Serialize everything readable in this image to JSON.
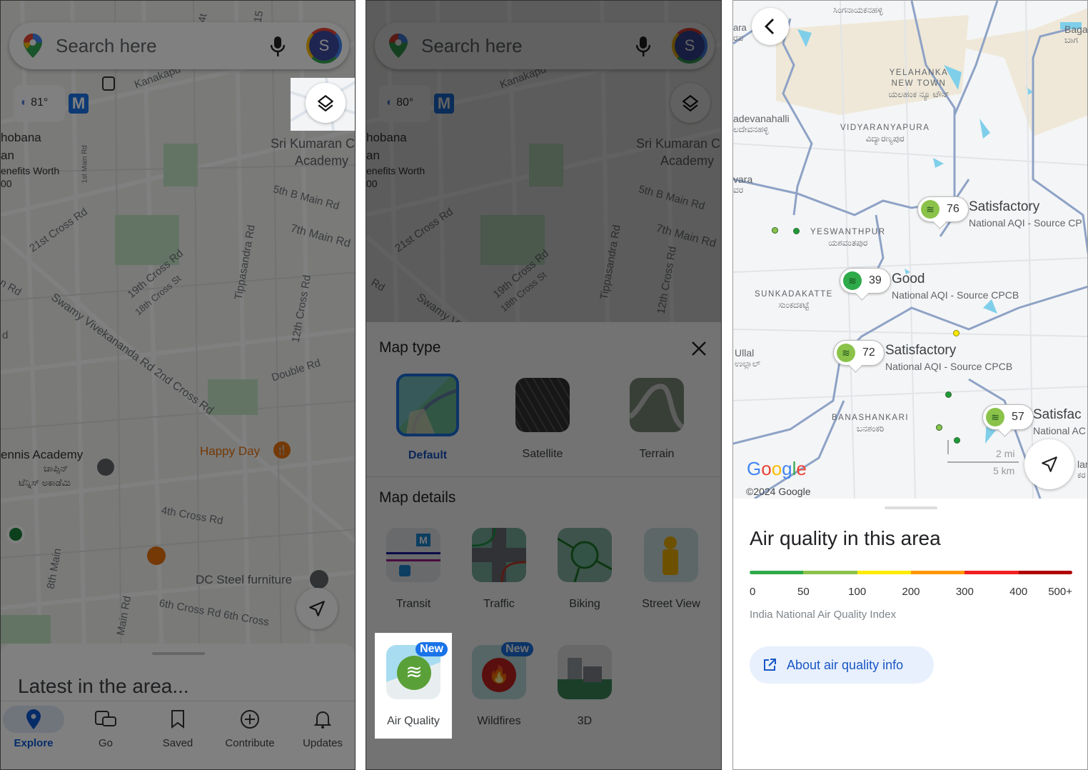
{
  "panel1": {
    "search_placeholder": "Search here",
    "avatar_letter": "S",
    "temperature": "81°",
    "metro_badge": "M",
    "map_labels": [
      "Kanakapu",
      "Sri Kumaran C",
      "Academy",
      "hobana",
      "an",
      "enefits Worth",
      "00",
      "1st Main Rd",
      "5th B Main Rd",
      "21st Cross Rd",
      "7th Main Rd",
      "19th Cross Rd",
      "18th Cross St",
      "Tippasandra Rd",
      "12th Cross Rd",
      "Swamy Vivekananda Rd 2nd Cross Rd",
      "Double Rd",
      "Happy Day",
      "ennis Academy",
      "ಚಾಪ್ಸಿನ್",
      "ಟೆನ್ನಿಸ್ ಅಕಾಡೆಮಿ",
      "4th Cross Rd",
      "8th Main",
      "DC Steel furniture",
      "6th Cross Rd 6th Cross",
      "Main Rd",
      "n Rd",
      "d",
      "4t",
      "15"
    ],
    "sheet_title": "Latest in the area...",
    "nav": [
      {
        "label": "Explore",
        "icon": "pin-icon",
        "active": true
      },
      {
        "label": "Go",
        "icon": "commute-icon"
      },
      {
        "label": "Saved",
        "icon": "bookmark-icon"
      },
      {
        "label": "Contribute",
        "icon": "plus-circle-icon"
      },
      {
        "label": "Updates",
        "icon": "bell-icon"
      }
    ]
  },
  "panel2": {
    "search_placeholder": "Search here",
    "avatar_letter": "S",
    "temperature": "80°",
    "metro_badge": "M",
    "map_labels": [
      "Kanakapu",
      "Sri Kumaran C",
      "Academy",
      "hobana",
      "an",
      "enefits Worth",
      "00",
      "5th B Main Rd",
      "21st Cross Rd",
      "7th Main Rd",
      "19th Cross Rd",
      "18th Cross St",
      "Tippasandra Rd",
      "12th Cross Rd",
      "Swamy Vi",
      "Rd"
    ],
    "map_type_title": "Map type",
    "map_types": [
      {
        "label": "Default",
        "selected": true
      },
      {
        "label": "Satellite"
      },
      {
        "label": "Terrain"
      }
    ],
    "map_details_title": "Map details",
    "details": [
      {
        "label": "Transit"
      },
      {
        "label": "Traffic"
      },
      {
        "label": "Biking"
      },
      {
        "label": "Street View"
      },
      {
        "label": "Air Quality",
        "badge": "New",
        "highlighted": true
      },
      {
        "label": "Wildfires",
        "badge": "New"
      },
      {
        "label": "3D"
      }
    ]
  },
  "panel3": {
    "places": [
      {
        "en": "",
        "kn": "ಸಿಂಗನಾಯಕನಹಳ್ಳಿ"
      },
      {
        "en": "YELAHANKA NEW TOWN",
        "kn": "ಯಲಹಂಕ ನ್ಯೂ ಟೌನ್"
      },
      {
        "en": "VIDYARANYAPURA",
        "kn": "ವಿದ್ಯಾರಣ್ಯಪುರ"
      },
      {
        "en": "adevanahalli",
        "kn": "ಲದೇವನಹಳ್ಳಿ"
      },
      {
        "en": "vara",
        "kn": "ವರ"
      },
      {
        "en": "ara",
        "kn": "ರಪ"
      },
      {
        "en": "Baga",
        "kn": "ಬಾಗ"
      },
      {
        "en": "YESWANTHPUR",
        "kn": "ಯಶವಂತಪುರ"
      },
      {
        "en": "SUNKADAKATTE",
        "kn": "ಸುಂಕದಕಟ್ಟೆ"
      },
      {
        "en": "Ullal",
        "kn": "ಉಲ್ಲಾಲ್"
      },
      {
        "en": "BANASHANKARI",
        "kn": "ಬನಶಂಕರಿ"
      },
      {
        "en": "lar",
        "kn": "ಕರ"
      }
    ],
    "aqi_markers": [
      {
        "value": "76",
        "status": "Satisfactory",
        "source": "National AQI - Source CP",
        "color": "#8bc34a"
      },
      {
        "value": "39",
        "status": "Good",
        "source": "National AQI - Source CPCB",
        "color": "#2eaa4a"
      },
      {
        "value": "72",
        "status": "Satisfactory",
        "source": "National AQI - Source CPCB",
        "color": "#8bc34a"
      },
      {
        "value": "57",
        "status": "Satisfac",
        "source": "National AC",
        "color": "#8bc34a"
      }
    ],
    "scale": {
      "mi": "2 mi",
      "km": "5 km"
    },
    "logo": "Google",
    "copyright": "©2024 Google",
    "sheet": {
      "title": "Air quality in this area",
      "scale_colors": [
        "#2eaa4a",
        "#8bc34a",
        "#ffeb00",
        "#ff9800",
        "#f02020",
        "#b00000"
      ],
      "scale_labels": [
        "0",
        "50",
        "100",
        "200",
        "300",
        "400",
        "500+"
      ],
      "index_name": "India National Air Quality Index",
      "about_button": "About air quality info"
    }
  }
}
